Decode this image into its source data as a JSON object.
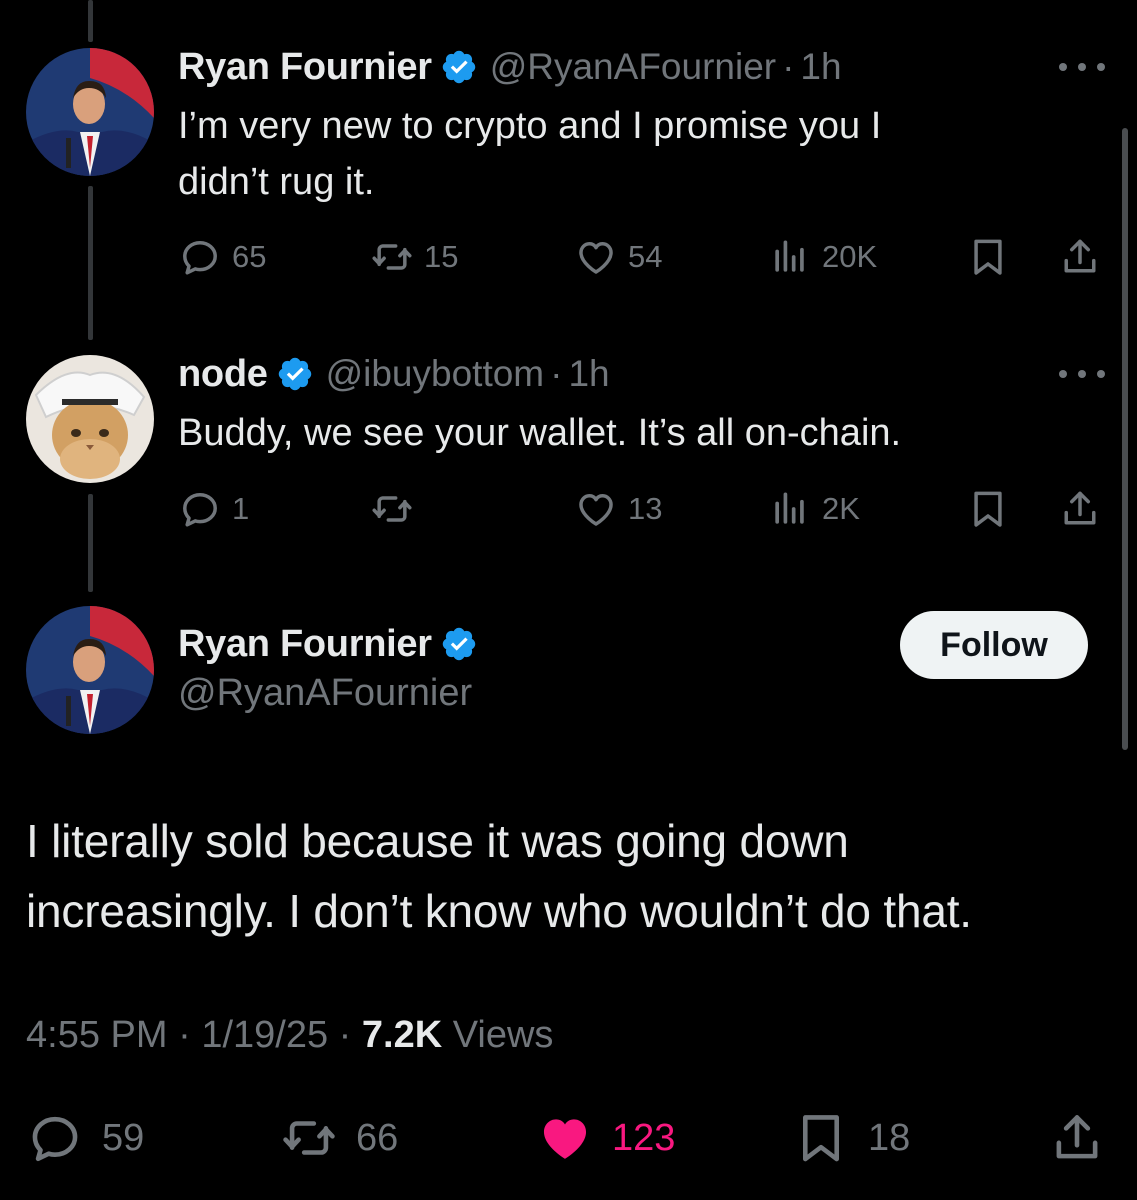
{
  "colors": {
    "background": "#000000",
    "text": "#e7e9ea",
    "secondary": "#71767b",
    "verified": "#1d9bf0",
    "like_active": "#f91880"
  },
  "tweets": [
    {
      "name": "Ryan Fournier",
      "handle": "@RyanAFournier",
      "separator": "·",
      "time": "1h",
      "text_lines": [
        "I’m very new to crypto and I promise you I",
        "didn’t rug it."
      ],
      "replies": "65",
      "reposts": "15",
      "likes": "54",
      "views": "20K"
    },
    {
      "name": "node",
      "handle": "@ibuybottom",
      "separator": "·",
      "time": "1h",
      "text_lines": [
        "Buddy, we see your wallet. It’s all on-chain."
      ],
      "replies": "1",
      "reposts": "",
      "likes": "13",
      "views": "2K"
    }
  ],
  "main_tweet": {
    "name": "Ryan Fournier",
    "handle": "@RyanAFournier",
    "follow_label": "Follow",
    "text_lines": [
      "I literally sold because it was going down",
      "increasingly. I don’t know who wouldn’t do that."
    ],
    "time": "4:55 PM",
    "date": "1/19/25",
    "separator": "·",
    "views_count": "7.2K",
    "views_label": "Views",
    "replies": "59",
    "reposts": "66",
    "likes": "123",
    "bookmarks": "18"
  },
  "icons": {
    "verified": "verified-badge-icon",
    "more": "more-horizontal-icon",
    "reply": "reply-icon",
    "repost": "repost-icon",
    "like": "heart-icon",
    "views": "views-chart-icon",
    "bookmark": "bookmark-icon",
    "share": "share-icon"
  }
}
